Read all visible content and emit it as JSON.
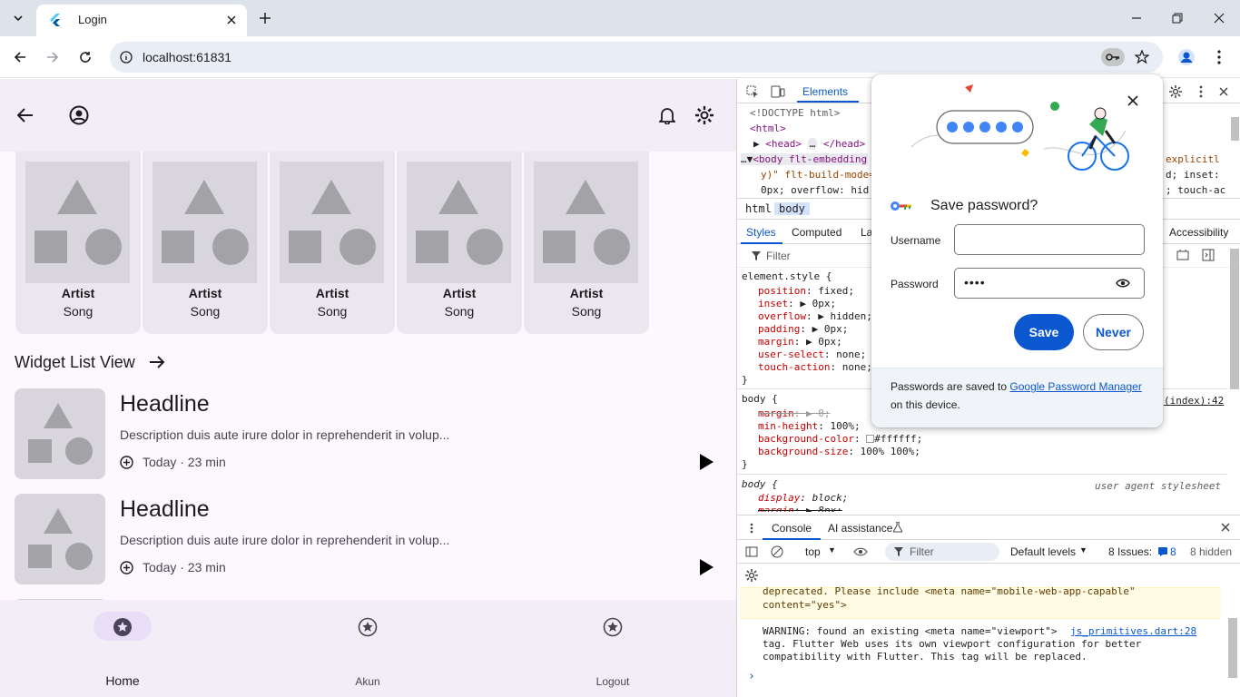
{
  "browser": {
    "tab_title": "Login",
    "url": "localhost:61831"
  },
  "app": {
    "cards": [
      {
        "artist": "Artist",
        "song": "Song"
      },
      {
        "artist": "Artist",
        "song": "Song"
      },
      {
        "artist": "Artist",
        "song": "Song"
      },
      {
        "artist": "Artist",
        "song": "Song"
      },
      {
        "artist": "Artist",
        "song": "Song"
      }
    ],
    "section_title": "Widget List View",
    "list": [
      {
        "headline": "Headline",
        "description": "Description duis aute irure dolor in reprehenderit in volup...",
        "meta": "Today · 23 min"
      },
      {
        "headline": "Headline",
        "description": "Description duis aute irure dolor in reprehenderit in volup...",
        "meta": "Today · 23 min"
      }
    ],
    "nav": [
      {
        "label": "Home",
        "active": true
      },
      {
        "label": "Akun",
        "active": false
      },
      {
        "label": "Logout",
        "active": false
      }
    ]
  },
  "devtools": {
    "panel_tab": "Elements",
    "dom_lines": {
      "doctype": "<!DOCTYPE html>",
      "html_open": "<html>",
      "head": "<head>",
      "head_dots": "…",
      "head_close": "</head>",
      "body_open": "<body flt-embedding",
      "body_cont1": "y)\" flt-build-mode=",
      "body_cont2": "0px; overflow: hid",
      "right1": "explicitl",
      "right2": "d; inset:",
      "right3": "; touch-ac"
    },
    "breadcrumbs": [
      "html",
      "body"
    ],
    "subtabs": {
      "styles": "Styles",
      "computed": "Computed",
      "layout": "La",
      "accessibility": "Accessibility"
    },
    "filter_placeholder": "Filter",
    "styles": {
      "element_style": "element.style {",
      "decls": [
        {
          "p": "position",
          "v": "fixed;"
        },
        {
          "p": "inset",
          "v": "▶ 0px;"
        },
        {
          "p": "overflow",
          "v": "▶ hidden;"
        },
        {
          "p": "padding",
          "v": "▶ 0px;"
        },
        {
          "p": "margin",
          "v": "▶ 0px;"
        },
        {
          "p": "user-select",
          "v": "none;"
        },
        {
          "p": "touch-action",
          "v": "none;"
        }
      ],
      "close": "}",
      "body_rule": "body {",
      "body_source": "(index):42",
      "body_decls": [
        {
          "p": "margin",
          "v": "▶ 0;",
          "struck": true
        },
        {
          "p": "min-height",
          "v": "100%;"
        },
        {
          "p": "background-color",
          "v": "#ffffff;"
        },
        {
          "p": "background-size",
          "v": "100% 100%;"
        }
      ],
      "ua_rule": "body {",
      "ua_source": "user agent stylesheet",
      "ua_decls": [
        {
          "p": "display",
          "v": "block;"
        },
        {
          "p": "margin",
          "v": "▶ 8px;",
          "struck": true
        }
      ]
    },
    "drawer": {
      "tabs": [
        "Console",
        "AI assistance"
      ],
      "context": "top",
      "filter": "Filter",
      "levels": "Default levels",
      "issues_label": "8 Issues:",
      "issues_count": "8",
      "hidden": "8 hidden",
      "warn_line1": "deprecated. Please include <meta name=\"mobile-web-app-capable\"",
      "warn_line2": "content=\"yes\">",
      "msg_line1": "WARNING: found an existing <meta name=\"viewport\">",
      "msg_link": "js_primitives.dart:28",
      "msg_line2": "tag. Flutter Web uses its own viewport configuration for better",
      "msg_line3": "compatibility with Flutter. This tag will be replaced.",
      "prompt": "›"
    }
  },
  "password_popup": {
    "title": "Save password?",
    "username_label": "Username",
    "username_value": "",
    "password_label": "Password",
    "password_value": "••••",
    "save": "Save",
    "never": "Never",
    "footer_text": "Passwords are saved to",
    "footer_link": "Google Password Manager",
    "footer_text2": "on this device."
  },
  "colors": {
    "accent": "#0b57d0",
    "app_bg": "#fdf7fe",
    "appbar_bg": "#f3edf7",
    "nav_active_pill": "#e8def8"
  }
}
